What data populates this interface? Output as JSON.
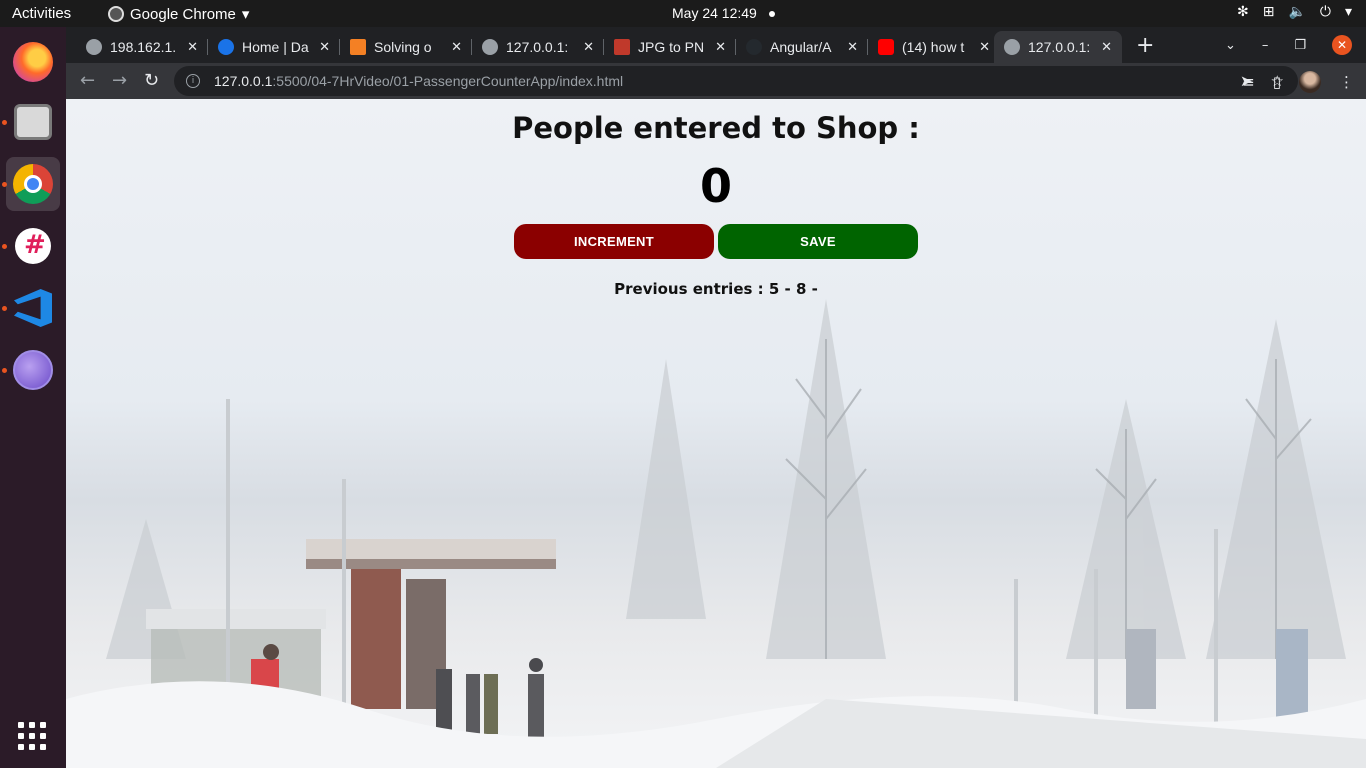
{
  "topbar": {
    "activities": "Activities",
    "app_name": "Google Chrome",
    "clock": "May 24  12:49"
  },
  "dock": {
    "apps": [
      "firefox-icon",
      "files-icon",
      "chrome-icon",
      "slack-icon",
      "vscode-icon",
      "globe-icon"
    ]
  },
  "tabs": [
    {
      "title": "198.162.1.",
      "active": false
    },
    {
      "title": "Home | Da",
      "active": false
    },
    {
      "title": "Solving o",
      "active": false
    },
    {
      "title": "127.0.0.1:",
      "active": false
    },
    {
      "title": "JPG to PN",
      "active": false
    },
    {
      "title": "Angular/A",
      "active": false
    },
    {
      "title": "(14) how t",
      "active": false
    },
    {
      "title": "127.0.0.1:",
      "active": true
    }
  ],
  "omnibox": {
    "host": "127.0.0.1",
    "path": ":5500/04-7HrVideo/01-PassengerCounterApp/index.html"
  },
  "page": {
    "heading": "People entered to Shop :",
    "count": "0",
    "increment_label": "INCREMENT",
    "save_label": "SAVE",
    "previous_entries": "Previous entries : 5 - 8 -"
  },
  "colors": {
    "increment": "#8b0000",
    "save": "#006400"
  }
}
